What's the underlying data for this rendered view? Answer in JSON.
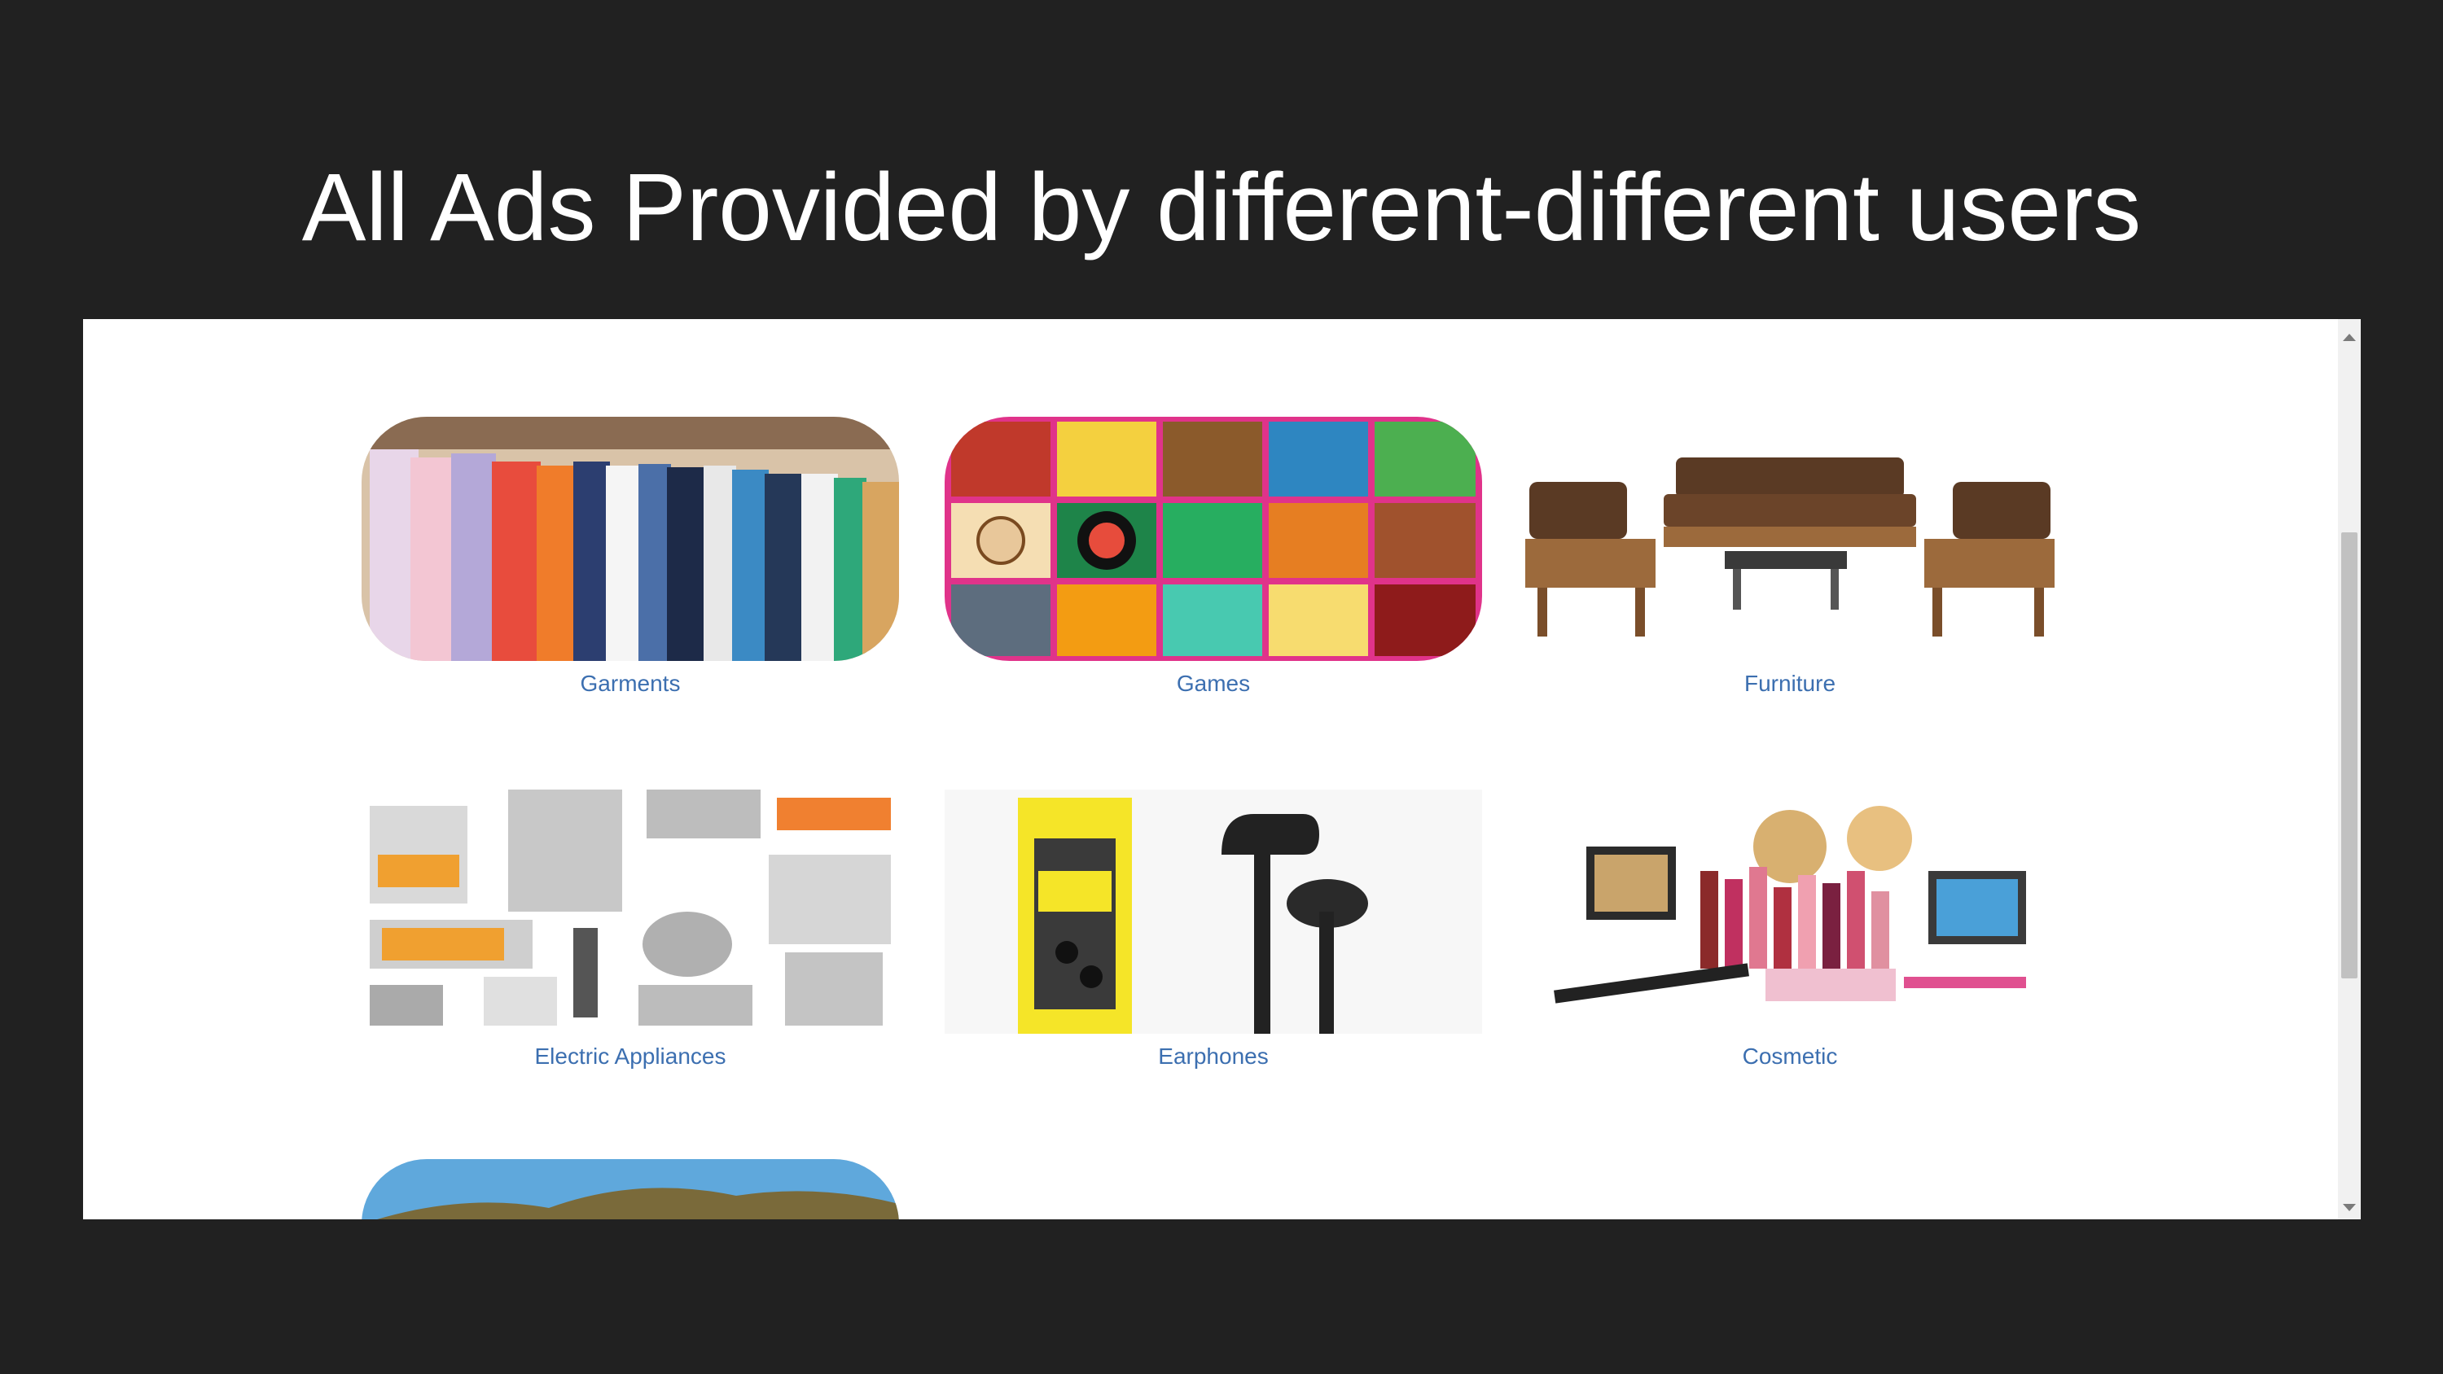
{
  "slide": {
    "title": "All Ads Provided by different-different users"
  },
  "categories": [
    {
      "label": "Garments",
      "icon": "clothing-rack-image"
    },
    {
      "label": "Games",
      "icon": "board-games-image"
    },
    {
      "label": "Furniture",
      "icon": "sofa-set-image"
    },
    {
      "label": "Electric Appliances",
      "icon": "kitchen-appliances-image"
    },
    {
      "label": "Earphones",
      "icon": "earphones-image"
    },
    {
      "label": "Cosmetic",
      "icon": "makeup-products-image"
    }
  ],
  "colors": {
    "background": "#212121",
    "title": "#ffffff",
    "panel": "#ffffff",
    "label": "#3c6fb0"
  }
}
